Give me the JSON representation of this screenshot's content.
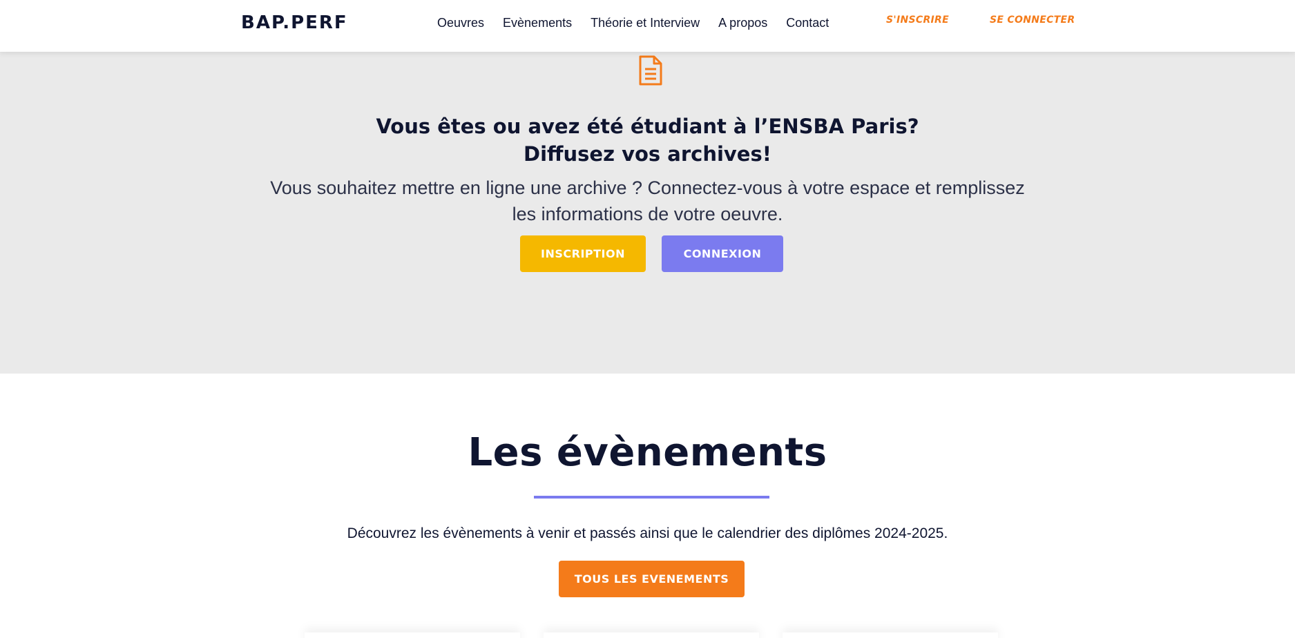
{
  "header": {
    "logo": "BAP.PERF",
    "nav": [
      {
        "label": "Oeuvres"
      },
      {
        "label": "Evènements"
      },
      {
        "label": "Théorie et Interview"
      },
      {
        "label": "A propos"
      },
      {
        "label": "Contact"
      }
    ],
    "signup_label": "S'INSCRIRE",
    "login_label": "SE CONNECTER"
  },
  "hero": {
    "icon": "document-icon",
    "title_line1": "Vous êtes ou avez été étudiant à l’ENSBA Paris?",
    "title_line2": "Diffusez vos archives!",
    "text": "Vous souhaitez mettre en ligne une archive ? Connectez-vous à votre espace et remplissez les informations de votre oeuvre.",
    "inscription_label": "INSCRIPTION",
    "connexion_label": "CONNEXION"
  },
  "events": {
    "title": "Les évènements",
    "text": "Découvrez les évènements à venir et passés ainsi que le calendrier des diplômes 2024-2025.",
    "button_label": "TOUS LES EVENEMENTS"
  },
  "colors": {
    "accent_orange": "#f47b1a",
    "accent_yellow": "#f5b800",
    "accent_violet": "#7b7bef",
    "hero_bg": "#eaeaea",
    "text_dark": "#0f1530"
  }
}
